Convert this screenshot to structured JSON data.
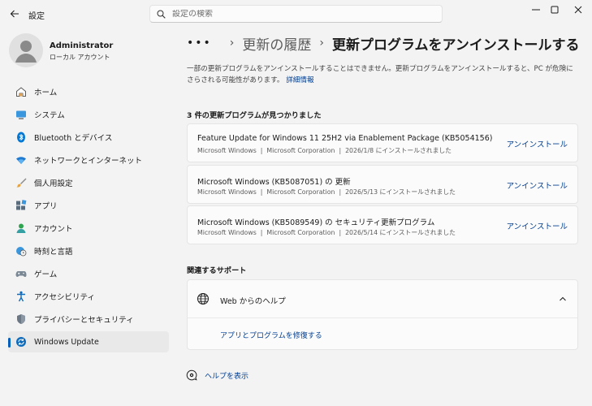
{
  "window": {
    "title": "設定",
    "search_placeholder": "設定の検索"
  },
  "profile": {
    "name": "Administrator",
    "account_type": "ローカル アカウント"
  },
  "sidebar": {
    "items": [
      {
        "label": "ホーム",
        "icon": "home-icon",
        "active": false
      },
      {
        "label": "システム",
        "icon": "system-icon",
        "active": false
      },
      {
        "label": "Bluetooth とデバイス",
        "icon": "bluetooth-icon",
        "active": false
      },
      {
        "label": "ネットワークとインターネット",
        "icon": "wifi-icon",
        "active": false
      },
      {
        "label": "個人用設定",
        "icon": "brush-icon",
        "active": false
      },
      {
        "label": "アプリ",
        "icon": "apps-icon",
        "active": false
      },
      {
        "label": "アカウント",
        "icon": "account-icon",
        "active": false
      },
      {
        "label": "時刻と言語",
        "icon": "clock-globe-icon",
        "active": false
      },
      {
        "label": "ゲーム",
        "icon": "gamepad-icon",
        "active": false
      },
      {
        "label": "アクセシビリティ",
        "icon": "accessibility-icon",
        "active": false
      },
      {
        "label": "プライバシーとセキュリティ",
        "icon": "shield-icon",
        "active": false
      },
      {
        "label": "Windows Update",
        "icon": "windows-update-icon",
        "active": true
      }
    ]
  },
  "breadcrumb": {
    "more": "•••",
    "parent": "更新の履歴",
    "current": "更新プログラムをアンインストールする"
  },
  "description": {
    "text": "一部の更新プログラムをアンインストールすることはできません。更新プログラムをアンインストールすると、PC が危険にさらされる可能性があります。",
    "link": "詳細情報"
  },
  "updates": {
    "count_label": "3 件の更新プログラムが見つかりました",
    "uninstall_label": "アンインストール",
    "items": [
      {
        "title": "Feature Update for Windows 11 25H2 via Enablement Package (KB5054156)",
        "product": "Microsoft Windows",
        "publisher": "Microsoft Corporation",
        "installed": "2026/1/8 にインストールされました"
      },
      {
        "title": "Microsoft Windows (KB5087051) の 更新",
        "product": "Microsoft Windows",
        "publisher": "Microsoft Corporation",
        "installed": "2026/5/13 にインストールされました"
      },
      {
        "title": "Microsoft Windows (KB5089549) の セキュリティ更新プログラム",
        "product": "Microsoft Windows",
        "publisher": "Microsoft Corporation",
        "installed": "2026/5/14 にインストールされました"
      }
    ]
  },
  "support": {
    "section_label": "関連するサポート",
    "title": "Web からのヘルプ",
    "link": "アプリとプログラムを修復する"
  },
  "help": {
    "label": "ヘルプを表示"
  },
  "colors": {
    "accent": "#005fb8",
    "link": "#003e92",
    "background": "#f3f3f3",
    "card": "#fbfbfb"
  }
}
